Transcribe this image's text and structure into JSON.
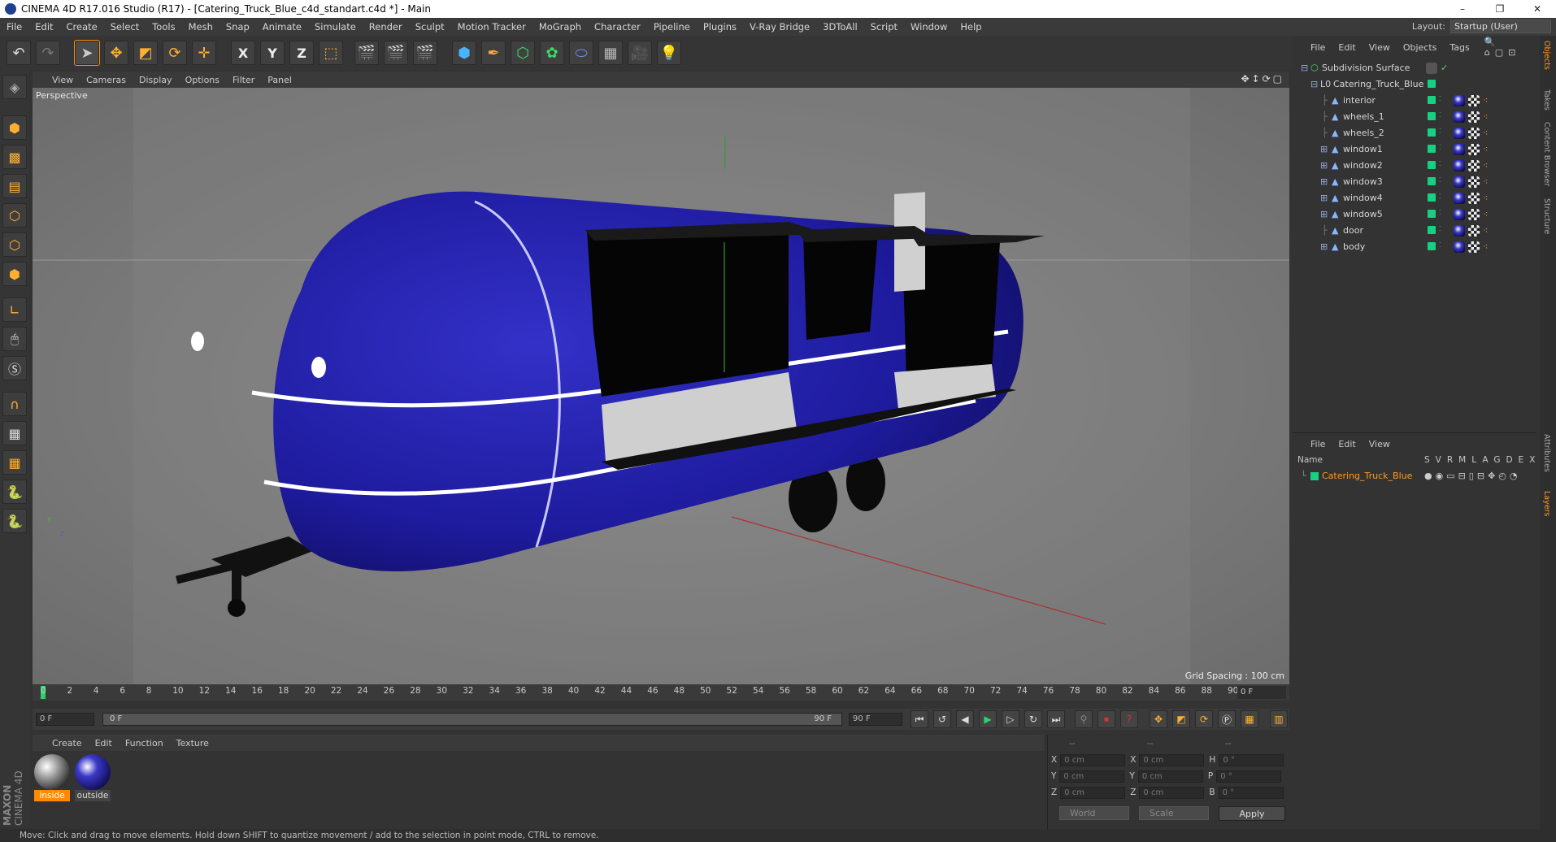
{
  "window": {
    "title": "CINEMA 4D R17.016 Studio (R17) - [Catering_Truck_Blue_c4d_standart.c4d *] - Main",
    "btn_min": "–",
    "btn_max": "❐",
    "btn_close": "✕"
  },
  "menubar": {
    "items": [
      "File",
      "Edit",
      "Create",
      "Select",
      "Tools",
      "Mesh",
      "Snap",
      "Animate",
      "Simulate",
      "Render",
      "Sculpt",
      "Motion Tracker",
      "MoGraph",
      "Character",
      "Pipeline",
      "Plugins",
      "V-Ray Bridge",
      "3DToAll",
      "Script",
      "Window",
      "Help"
    ],
    "layout_label": "Layout:",
    "layout_value": "Startup (User)"
  },
  "toolbar": {
    "axis_x": "X",
    "axis_y": "Y",
    "axis_z": "Z"
  },
  "viewport": {
    "menu": [
      "View",
      "Cameras",
      "Display",
      "Options",
      "Filter",
      "Panel"
    ],
    "camera": "Perspective",
    "grid_spacing": "Grid Spacing : 100 cm",
    "axis_y": "y",
    "axis_z": "z"
  },
  "timeline": {
    "ticks": [
      "0",
      "2",
      "4",
      "6",
      "8",
      "10",
      "12",
      "14",
      "16",
      "18",
      "20",
      "22",
      "24",
      "26",
      "28",
      "30",
      "32",
      "34",
      "36",
      "38",
      "40",
      "42",
      "44",
      "46",
      "48",
      "50",
      "52",
      "54",
      "56",
      "58",
      "60",
      "62",
      "64",
      "66",
      "68",
      "70",
      "72",
      "74",
      "76",
      "78",
      "80",
      "82",
      "84",
      "86",
      "88",
      "90"
    ],
    "current_frame": "0 F"
  },
  "playbar": {
    "start": "0 F",
    "range_start": "0 F",
    "range_end": "90 F",
    "end": "90 F"
  },
  "materials": {
    "menu": [
      "Create",
      "Edit",
      "Function",
      "Texture"
    ],
    "items": [
      {
        "name": "inside"
      },
      {
        "name": "outside"
      }
    ],
    "brand_top": "MAXON",
    "brand_bottom": "CINEMA 4D"
  },
  "coords": {
    "header_1": "--",
    "header_2": "--",
    "header_3": "--",
    "x_label": "X",
    "y_label": "Y",
    "z_label": "Z",
    "x2_label": "X",
    "y2_label": "Y",
    "z2_label": "Z",
    "h_label": "H",
    "p_label": "P",
    "b_label": "B",
    "x": "0 cm",
    "y": "0 cm",
    "z": "0 cm",
    "x2": "0 cm",
    "y2": "0 cm",
    "z2": "0 cm",
    "h": "0 °",
    "p": "0 °",
    "b": "0 °",
    "mode1": "World",
    "mode2": "Scale",
    "apply": "Apply"
  },
  "objects": {
    "menu": [
      "File",
      "Edit",
      "View",
      "Objects",
      "Tags"
    ],
    "tree": [
      {
        "name": "Subdivision Surface",
        "level": 0
      },
      {
        "name": "Catering_Truck_Blue",
        "level": 1
      },
      {
        "name": "interior",
        "level": 2
      },
      {
        "name": "wheels_1",
        "level": 2
      },
      {
        "name": "wheels_2",
        "level": 2
      },
      {
        "name": "window1",
        "level": 2
      },
      {
        "name": "window2",
        "level": 2
      },
      {
        "name": "window3",
        "level": 2
      },
      {
        "name": "window4",
        "level": 2
      },
      {
        "name": "window5",
        "level": 2
      },
      {
        "name": "door",
        "level": 2
      },
      {
        "name": "body",
        "level": 2
      }
    ]
  },
  "layers": {
    "menu": [
      "File",
      "Edit",
      "View"
    ],
    "header_name": "Name",
    "header_cols": [
      "S",
      "V",
      "R",
      "M",
      "L",
      "A",
      "G",
      "D",
      "E",
      "X"
    ],
    "row_name": "Catering_Truck_Blue"
  },
  "sidetabs": [
    "Objects",
    "Takes",
    "Content Browser",
    "Structure",
    "Attributes",
    "Layers"
  ],
  "status": "Move: Click and drag to move elements. Hold down SHIFT to quantize movement / add to the selection in point mode, CTRL to remove.",
  "colors": {
    "accent": "#ff8a00",
    "layer_green": "#17d081",
    "truck_blue": "#1e1b9e"
  }
}
